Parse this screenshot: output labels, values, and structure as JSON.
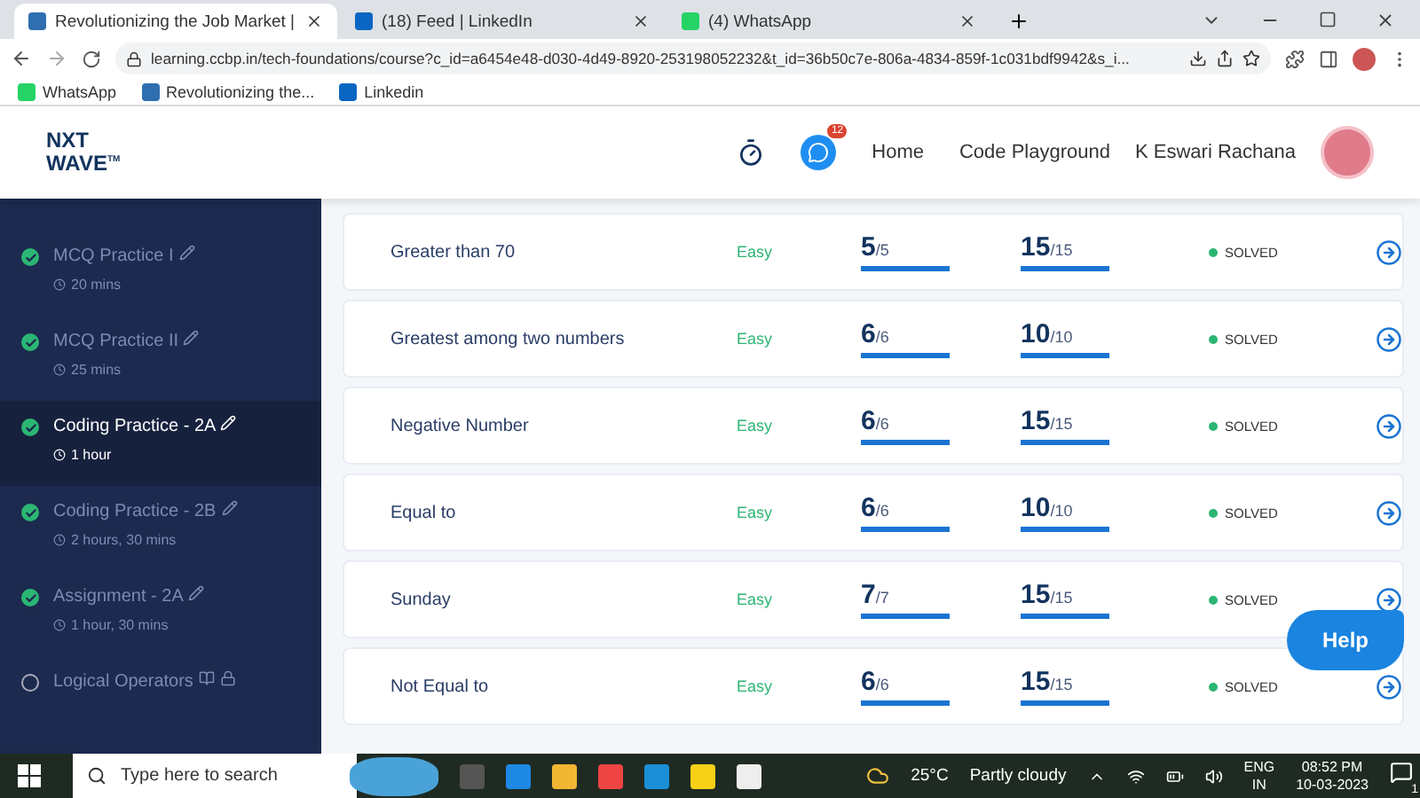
{
  "browser": {
    "tabs": [
      {
        "title": "Revolutionizing the Job Market |",
        "selected": true
      },
      {
        "title": "(18) Feed | LinkedIn",
        "selected": false
      },
      {
        "title": "(4) WhatsApp",
        "selected": false
      }
    ],
    "address": "learning.ccbp.in/tech-foundations/course?c_id=a6454e48-d030-4d49-8920-253198052232&t_id=36b50c7e-806a-4834-859f-1c031bdf9942&s_i...",
    "bookmarks": [
      "WhatsApp",
      "Revolutionizing the...",
      "Linkedin"
    ]
  },
  "header": {
    "logo_top": "NXT",
    "logo_bottom": "WAVE",
    "logo_mark": "TM",
    "chat_badge": "12",
    "nav": [
      "Home",
      "Code Playground"
    ],
    "user": "K Eswari Rachana"
  },
  "sidebar": {
    "items": [
      {
        "title": "MCQ Practice I",
        "time": "20 mins",
        "done": true,
        "selected": false,
        "kind": "edit"
      },
      {
        "title": "MCQ Practice II",
        "time": "25 mins",
        "done": true,
        "selected": false,
        "kind": "edit"
      },
      {
        "title": "Coding Practice - 2A",
        "time": "1 hour",
        "done": true,
        "selected": true,
        "kind": "edit"
      },
      {
        "title": "Coding Practice - 2B",
        "time": "2 hours, 30 mins",
        "done": true,
        "selected": false,
        "kind": "edit"
      },
      {
        "title": "Assignment - 2A",
        "time": "1 hour, 30 mins",
        "done": true,
        "selected": false,
        "kind": "edit"
      },
      {
        "title": "Logical Operators",
        "done": false,
        "selected": false,
        "kind": "reading"
      }
    ]
  },
  "problems": [
    {
      "title": "Greater than 70",
      "difficulty": "Easy",
      "score": {
        "value": "5",
        "max": "/5",
        "level": 1
      },
      "tests": {
        "value": "15",
        "max": "/15",
        "level": 1
      },
      "status": "SOLVED"
    },
    {
      "title": "Greatest among two numbers",
      "difficulty": "Easy",
      "score": {
        "value": "6",
        "max": "/6",
        "level": 1
      },
      "tests": {
        "value": "10",
        "max": "/10",
        "level": 1
      },
      "status": "SOLVED"
    },
    {
      "title": "Negative Number",
      "difficulty": "Easy",
      "score": {
        "value": "6",
        "max": "/6",
        "level": 1
      },
      "tests": {
        "value": "15",
        "max": "/15",
        "level": 1
      },
      "status": "SOLVED"
    },
    {
      "title": "Equal to",
      "difficulty": "Easy",
      "score": {
        "value": "6",
        "max": "/6",
        "level": 1
      },
      "tests": {
        "value": "10",
        "max": "/10",
        "level": 1
      },
      "status": "SOLVED"
    },
    {
      "title": "Sunday",
      "difficulty": "Easy",
      "score": {
        "value": "7",
        "max": "/7",
        "level": 1
      },
      "tests": {
        "value": "15",
        "max": "/15",
        "level": 1
      },
      "status": "SOLVED"
    },
    {
      "title": "Not Equal to",
      "difficulty": "Easy",
      "score": {
        "value": "6",
        "max": "/6",
        "level": 1
      },
      "tests": {
        "value": "15",
        "max": "/15",
        "level": 1
      },
      "status": "SOLVED"
    }
  ],
  "help": "Help",
  "taskbar": {
    "search_placeholder": "Type here to search",
    "temperature": "25°C",
    "weather": "Partly cloudy",
    "lang": "ENG",
    "region": "IN",
    "time": "08:52 PM",
    "date": "10-03-2023",
    "notifications": "1"
  }
}
